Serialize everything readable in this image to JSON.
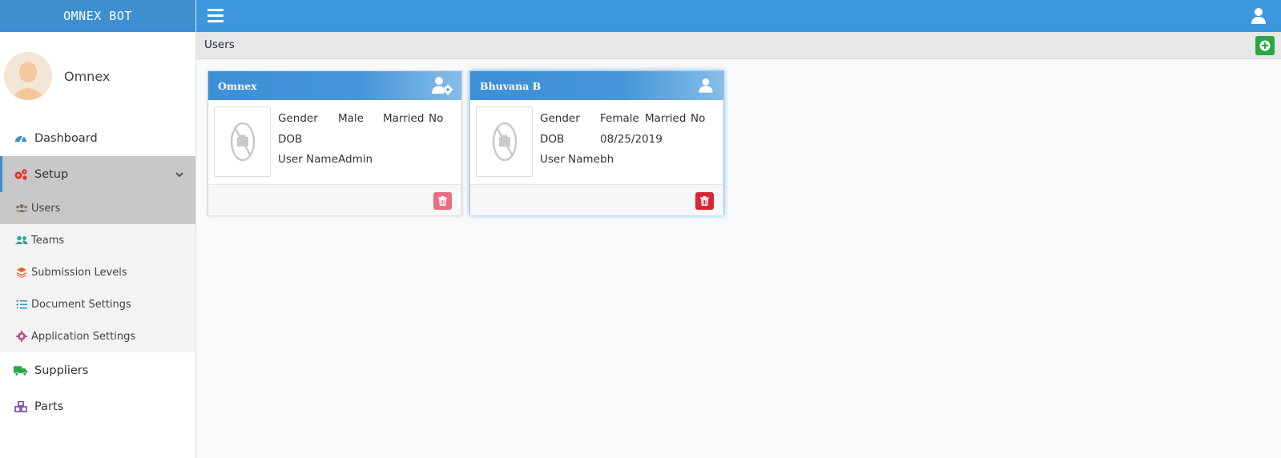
{
  "app": {
    "brand": "OMNEX BOT"
  },
  "profile": {
    "name": "Omnex"
  },
  "nav": {
    "dashboard": "Dashboard",
    "setup": "Setup",
    "setup_items": {
      "users": "Users",
      "teams": "Teams",
      "submission_levels": "Submission Levels",
      "document_settings": "Document Settings",
      "application_settings": "Application Settings"
    },
    "suppliers": "Suppliers",
    "parts": "Parts"
  },
  "page": {
    "title": "Users"
  },
  "users": [
    {
      "name": "Omnex",
      "gender_label": "Gender",
      "gender": "Male",
      "married_label": "Married",
      "married": "No",
      "dob_label": "DOB",
      "dob": "",
      "username_label": "User Name",
      "username": "Admin"
    },
    {
      "name": "Bhuvana B",
      "gender_label": "Gender",
      "gender": "Female",
      "married_label": "Married",
      "married": "No",
      "dob_label": "DOB",
      "dob": "08/25/2019",
      "username_label": "User Name",
      "username": "bh"
    }
  ],
  "colors": {
    "topbar": "#3d97dd",
    "brand_bar": "#3d8fcf",
    "add_button": "#28a745",
    "delete_light": "#e96f80",
    "delete_strong": "#dc2438"
  },
  "icons": {
    "menu": "hamburger-icon",
    "account": "user-icon",
    "add": "plus-circle-icon",
    "delete": "trash-icon",
    "no_photo": "no-camera-icon"
  }
}
